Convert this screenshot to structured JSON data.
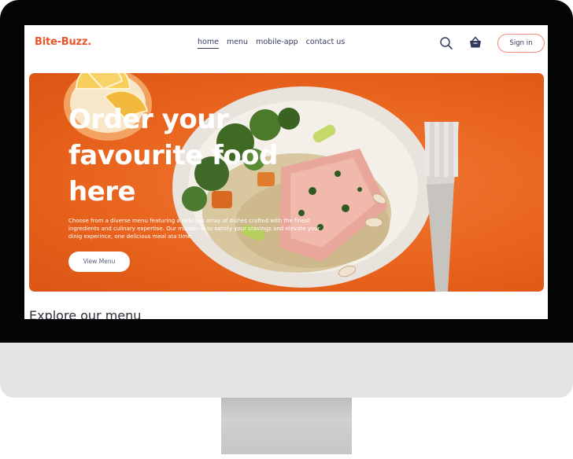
{
  "brand": {
    "logo": "Bite-Buzz."
  },
  "nav": {
    "items": [
      {
        "label": "home",
        "active": true
      },
      {
        "label": "menu",
        "active": false
      },
      {
        "label": "mobile-app",
        "active": false
      },
      {
        "label": "contact us",
        "active": false
      }
    ]
  },
  "header": {
    "search_icon": "search-icon",
    "basket_icon": "basket-icon",
    "signin_label": "Sign in"
  },
  "hero": {
    "headline": "Order your favourite food here",
    "description": "Choose from a diverse menu featuring a delicous array of dishes crafted with the finest ingredients and culinary expertise. Our mission is to satisfy your cravings and elevate your dinig experince, one delicious meal ata time.",
    "cta_label": "View Menu"
  },
  "explore": {
    "title": "Explore our menu"
  },
  "colors": {
    "brand": "#e8552b",
    "hero_orange": "#e9641e",
    "nav_text": "#333a5b"
  }
}
